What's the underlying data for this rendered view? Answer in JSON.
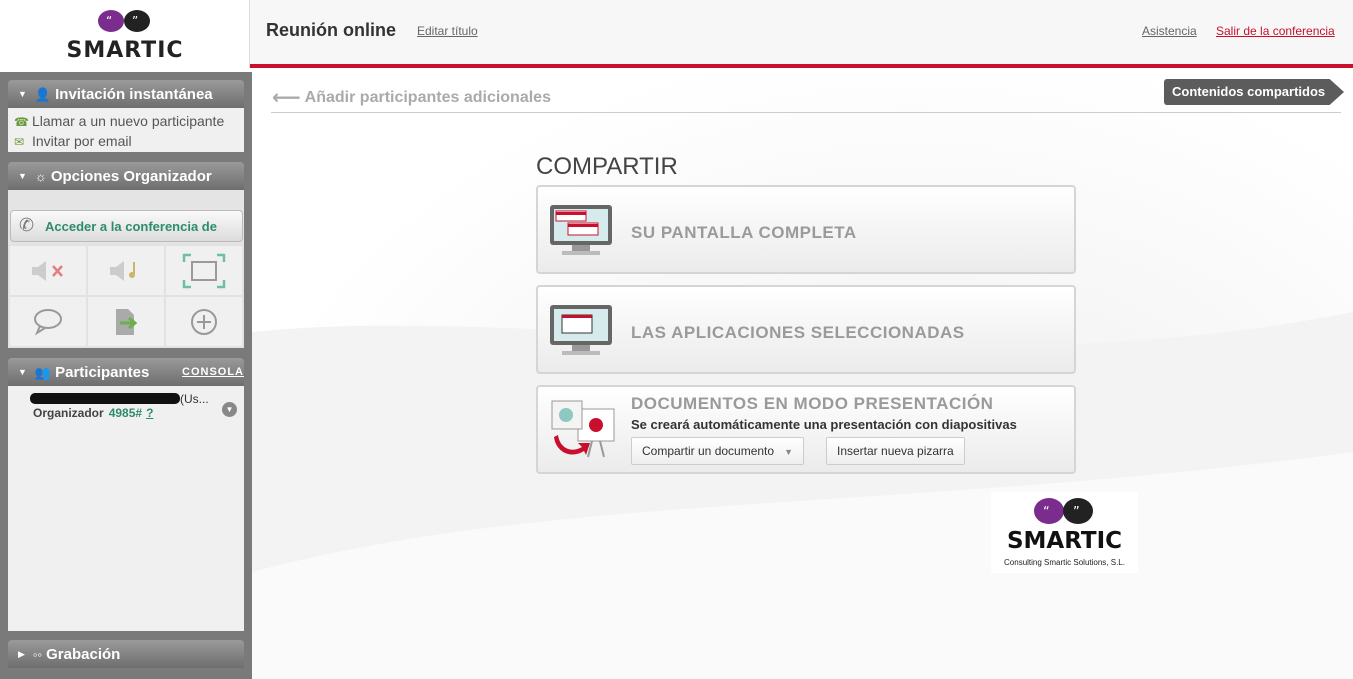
{
  "header": {
    "logo_text": "SMARTIC",
    "title": "Reunión online",
    "edit_title": "Editar título",
    "help": "Asistencia",
    "exit": "Salir de la conferencia"
  },
  "sidebar": {
    "invite": {
      "title": "Invitación instantánea",
      "call_new": "Llamar a un nuevo participante",
      "invite_email": "Invitar por email"
    },
    "organizer": {
      "title": "Opciones Organizador",
      "access": "Acceder a la conferencia de"
    },
    "participants": {
      "title": "Participantes",
      "console": "CONSOLA",
      "name_suffix": "(Us...",
      "role": "Organizador",
      "code": "4985#",
      "help": "?"
    },
    "recording": {
      "title": "Grabación"
    }
  },
  "main": {
    "add_participants": "Añadir participantes adicionales",
    "shared_contents": "Contenidos compartidos",
    "share_heading": "COMPARTIR",
    "full_screen": "SU PANTALLA COMPLETA",
    "selected_apps": "LAS APLICACIONES SELECCIONADAS",
    "presentation": {
      "title": "DOCUMENTOS EN MODO PRESENTACIÓN",
      "subtitle": "Se creará automáticamente una presentación con diapositivas",
      "share_doc": "Compartir un documento",
      "new_board": "Insertar nueva pizarra"
    },
    "corp_logo": {
      "name": "SMARTIC",
      "tagline": "Consulting Smartic Solutions, S.L."
    }
  },
  "colors": {
    "accent_red": "#c8102e",
    "link_green": "#2e8b6f",
    "sidebar_gray": "#7a7a7a"
  }
}
